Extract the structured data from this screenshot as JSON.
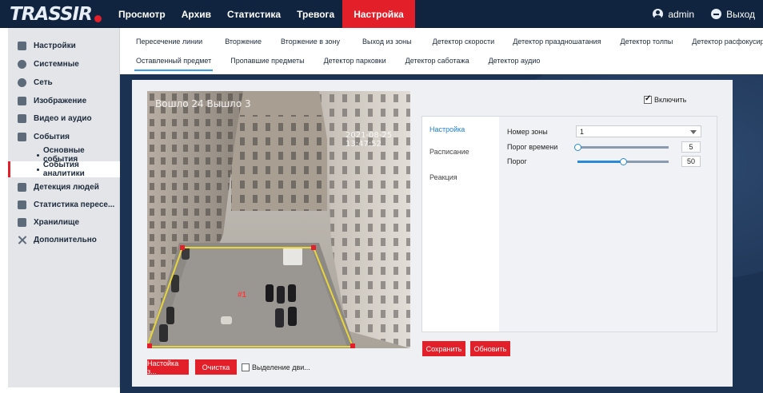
{
  "brand": "TRASSIR",
  "nav": [
    "Просмотр",
    "Архив",
    "Статистика",
    "Тревога",
    "Настройка"
  ],
  "user": {
    "name": "admin",
    "exit": "Выход"
  },
  "sidebar": {
    "items": [
      {
        "label": "Настройки"
      },
      {
        "label": "Системные"
      },
      {
        "label": "Сеть"
      },
      {
        "label": "Изображение"
      },
      {
        "label": "Видео и аудио"
      },
      {
        "label": "События"
      },
      {
        "label": "Основные события"
      },
      {
        "label": "События аналитики"
      },
      {
        "label": "Детекция людей"
      },
      {
        "label": "Статистика пересе..."
      },
      {
        "label": "Хранилище"
      },
      {
        "label": "Дополнительно"
      }
    ]
  },
  "tabs_row1": [
    "Пересечение линии",
    "Вторжение",
    "Вторжение в зону",
    "Выход из зоны",
    "Детектор скорости",
    "Детектор праздношатания",
    "Детектор толпы",
    "Детектор расфокусировки"
  ],
  "tabs_row2": [
    "Оставленный предмет",
    "Пропавшие предметы",
    "Детектор парковки",
    "Детектор саботажа",
    "Детектор аудио"
  ],
  "video": {
    "osd_title": "Вошло 24 Вышло 3",
    "osd_time": "2021-08-25 13:47:52",
    "zone_label": "#1"
  },
  "enable": {
    "label": "Включить",
    "checked": true
  },
  "card": {
    "tabs": [
      "Настройка",
      "Расписание",
      "Реакция"
    ],
    "zone_label": "Номер зоны",
    "zone_value": "1",
    "time_label": "Порог времени",
    "time_value": "5",
    "time_fraction": 0.0,
    "threshold_label": "Порог",
    "threshold_value": "50",
    "threshold_fraction": 0.5
  },
  "buttons": {
    "setup_zone": "Настойка з...",
    "clear": "Очистка",
    "motion_select": "Выделение дви...",
    "save": "Сохранить",
    "refresh": "Обновить"
  },
  "colors": {
    "accent": "#e3202a",
    "nav_bg": "#10243f",
    "link": "#1a7fd0"
  }
}
